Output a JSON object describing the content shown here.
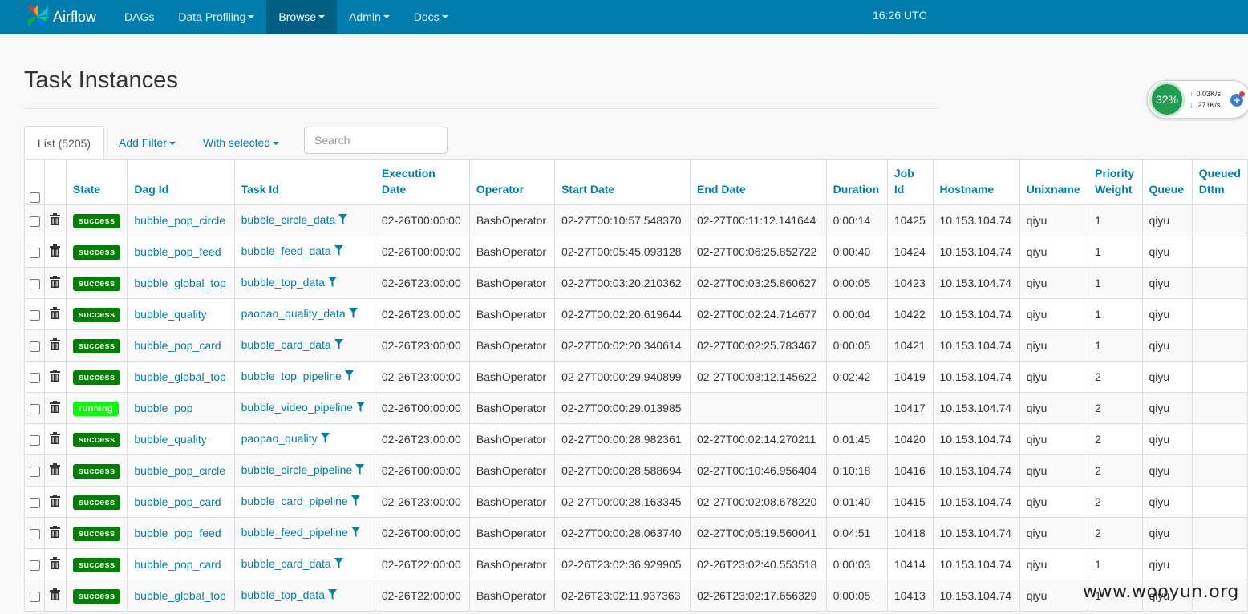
{
  "navbar": {
    "brand": "Airflow",
    "menu": [
      {
        "label": "DAGs",
        "dropdown": false,
        "active": false
      },
      {
        "label": "Data Profiling",
        "dropdown": true,
        "active": false
      },
      {
        "label": "Browse",
        "dropdown": true,
        "active": true
      },
      {
        "label": "Admin",
        "dropdown": true,
        "active": false
      },
      {
        "label": "Docs",
        "dropdown": true,
        "active": false
      }
    ],
    "clock": "16:26 UTC",
    "bg_color": "#017cac",
    "active_color": "#005f82"
  },
  "page": {
    "title": "Task Instances"
  },
  "toolbar": {
    "list_tab": "List (5205)",
    "add_filter": "Add Filter",
    "with_selected": "With selected",
    "search_placeholder": "Search"
  },
  "table": {
    "headers": [
      "State",
      "Dag Id",
      "Task Id",
      "Execution\nDate",
      "Operator",
      "Start Date",
      "End Date",
      "Duration",
      "Job\nId",
      "Hostname",
      "Unixname",
      "Priority\nWeight",
      "Queue",
      "Queued\nDttm"
    ],
    "rows": [
      {
        "state": "success",
        "dag_id": "bubble_pop_circle",
        "task_id": "bubble_circle_data",
        "execution_date": "02-26T00:00:00",
        "operator": "BashOperator",
        "start_date": "02-27T00:10:57.548370",
        "end_date": "02-27T00:11:12.141644",
        "duration": "0:00:14",
        "job_id": "10425",
        "hostname": "10.153.104.74",
        "unixname": "qiyu",
        "priority_weight": "1",
        "queue": "qiyu",
        "queued_dttm": ""
      },
      {
        "state": "success",
        "dag_id": "bubble_pop_feed",
        "task_id": "bubble_feed_data",
        "execution_date": "02-26T00:00:00",
        "operator": "BashOperator",
        "start_date": "02-27T00:05:45.093128",
        "end_date": "02-27T00:06:25.852722",
        "duration": "0:00:40",
        "job_id": "10424",
        "hostname": "10.153.104.74",
        "unixname": "qiyu",
        "priority_weight": "1",
        "queue": "qiyu",
        "queued_dttm": ""
      },
      {
        "state": "success",
        "dag_id": "bubble_global_top",
        "task_id": "bubble_top_data",
        "execution_date": "02-26T23:00:00",
        "operator": "BashOperator",
        "start_date": "02-27T00:03:20.210362",
        "end_date": "02-27T00:03:25.860627",
        "duration": "0:00:05",
        "job_id": "10423",
        "hostname": "10.153.104.74",
        "unixname": "qiyu",
        "priority_weight": "1",
        "queue": "qiyu",
        "queued_dttm": ""
      },
      {
        "state": "success",
        "dag_id": "bubble_quality",
        "task_id": "paopao_quality_data",
        "execution_date": "02-26T23:00:00",
        "operator": "BashOperator",
        "start_date": "02-27T00:02:20.619644",
        "end_date": "02-27T00:02:24.714677",
        "duration": "0:00:04",
        "job_id": "10422",
        "hostname": "10.153.104.74",
        "unixname": "qiyu",
        "priority_weight": "1",
        "queue": "qiyu",
        "queued_dttm": ""
      },
      {
        "state": "success",
        "dag_id": "bubble_pop_card",
        "task_id": "bubble_card_data",
        "execution_date": "02-26T23:00:00",
        "operator": "BashOperator",
        "start_date": "02-27T00:02:20.340614",
        "end_date": "02-27T00:02:25.783467",
        "duration": "0:00:05",
        "job_id": "10421",
        "hostname": "10.153.104.74",
        "unixname": "qiyu",
        "priority_weight": "1",
        "queue": "qiyu",
        "queued_dttm": ""
      },
      {
        "state": "success",
        "dag_id": "bubble_global_top",
        "task_id": "bubble_top_pipeline",
        "execution_date": "02-26T23:00:00",
        "operator": "BashOperator",
        "start_date": "02-27T00:00:29.940899",
        "end_date": "02-27T00:03:12.145622",
        "duration": "0:02:42",
        "job_id": "10419",
        "hostname": "10.153.104.74",
        "unixname": "qiyu",
        "priority_weight": "2",
        "queue": "qiyu",
        "queued_dttm": ""
      },
      {
        "state": "running",
        "dag_id": "bubble_pop",
        "task_id": "bubble_video_pipeline",
        "execution_date": "02-26T00:00:00",
        "operator": "BashOperator",
        "start_date": "02-27T00:00:29.013985",
        "end_date": "",
        "duration": "",
        "job_id": "10417",
        "hostname": "10.153.104.74",
        "unixname": "qiyu",
        "priority_weight": "2",
        "queue": "qiyu",
        "queued_dttm": ""
      },
      {
        "state": "success",
        "dag_id": "bubble_quality",
        "task_id": "paopao_quality",
        "execution_date": "02-26T23:00:00",
        "operator": "BashOperator",
        "start_date": "02-27T00:00:28.982361",
        "end_date": "02-27T00:02:14.270211",
        "duration": "0:01:45",
        "job_id": "10420",
        "hostname": "10.153.104.74",
        "unixname": "qiyu",
        "priority_weight": "2",
        "queue": "qiyu",
        "queued_dttm": ""
      },
      {
        "state": "success",
        "dag_id": "bubble_pop_circle",
        "task_id": "bubble_circle_pipeline",
        "execution_date": "02-26T00:00:00",
        "operator": "BashOperator",
        "start_date": "02-27T00:00:28.588694",
        "end_date": "02-27T00:10:46.956404",
        "duration": "0:10:18",
        "job_id": "10416",
        "hostname": "10.153.104.74",
        "unixname": "qiyu",
        "priority_weight": "2",
        "queue": "qiyu",
        "queued_dttm": ""
      },
      {
        "state": "success",
        "dag_id": "bubble_pop_card",
        "task_id": "bubble_card_pipeline",
        "execution_date": "02-26T23:00:00",
        "operator": "BashOperator",
        "start_date": "02-27T00:00:28.163345",
        "end_date": "02-27T00:02:08.678220",
        "duration": "0:01:40",
        "job_id": "10415",
        "hostname": "10.153.104.74",
        "unixname": "qiyu",
        "priority_weight": "2",
        "queue": "qiyu",
        "queued_dttm": ""
      },
      {
        "state": "success",
        "dag_id": "bubble_pop_feed",
        "task_id": "bubble_feed_pipeline",
        "execution_date": "02-26T00:00:00",
        "operator": "BashOperator",
        "start_date": "02-27T00:00:28.063740",
        "end_date": "02-27T00:05:19.560041",
        "duration": "0:04:51",
        "job_id": "10418",
        "hostname": "10.153.104.74",
        "unixname": "qiyu",
        "priority_weight": "2",
        "queue": "qiyu",
        "queued_dttm": ""
      },
      {
        "state": "success",
        "dag_id": "bubble_pop_card",
        "task_id": "bubble_card_data",
        "execution_date": "02-26T22:00:00",
        "operator": "BashOperator",
        "start_date": "02-26T23:02:36.929905",
        "end_date": "02-26T23:02:40.553518",
        "duration": "0:00:03",
        "job_id": "10414",
        "hostname": "10.153.104.74",
        "unixname": "qiyu",
        "priority_weight": "1",
        "queue": "qiyu",
        "queued_dttm": ""
      },
      {
        "state": "success",
        "dag_id": "bubble_global_top",
        "task_id": "bubble_top_data",
        "execution_date": "02-26T22:00:00",
        "operator": "BashOperator",
        "start_date": "02-26T23:02:11.937363",
        "end_date": "02-26T23:02:17.656329",
        "duration": "0:00:05",
        "job_id": "10413",
        "hostname": "10.153.104.74",
        "unixname": "qiyu",
        "priority_weight": "1",
        "queue": "qiyu",
        "queued_dttm": ""
      }
    ],
    "state_colors": {
      "success": "#008000",
      "running": "#01ff00"
    },
    "link_color": "#017cac"
  },
  "widget": {
    "percent": "32%",
    "upload": "0.03K/s",
    "download": "271K/s"
  },
  "watermark": "www.wooyun.org"
}
